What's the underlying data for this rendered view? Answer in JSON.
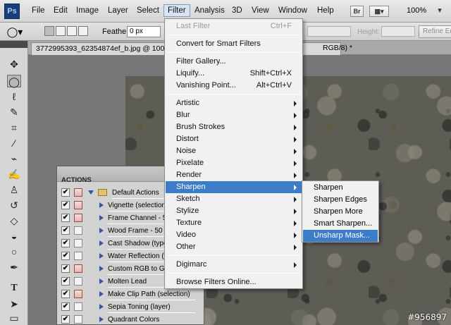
{
  "app": {
    "logo": "Ps"
  },
  "menubar": {
    "items": [
      "File",
      "Edit",
      "Image",
      "Layer",
      "Select",
      "Filter",
      "Analysis",
      "3D",
      "View",
      "Window",
      "Help"
    ],
    "active": "Filter",
    "br_button": "Br",
    "zoom": "100%"
  },
  "options": {
    "feather_label": "Feather:",
    "feather_value": "0 px",
    "height_label": "Height:",
    "refine_label": "Refine Ed"
  },
  "document": {
    "tab_title": "3772995393_62354874ef_b.jpg @ 100% (",
    "tab_title_tail": "RGB/8) *"
  },
  "filter_menu": {
    "last_filter": {
      "label": "Last Filter",
      "shortcut": "Ctrl+F"
    },
    "convert_smart": "Convert for Smart Filters",
    "filter_gallery": "Filter Gallery...",
    "liquify": {
      "label": "Liquify...",
      "shortcut": "Shift+Ctrl+X"
    },
    "vanishing_point": {
      "label": "Vanishing Point...",
      "shortcut": "Alt+Ctrl+V"
    },
    "categories": [
      "Artistic",
      "Blur",
      "Brush Strokes",
      "Distort",
      "Noise",
      "Pixelate",
      "Render",
      "Sharpen",
      "Sketch",
      "Stylize",
      "Texture",
      "Video",
      "Other"
    ],
    "highlighted": "Sharpen",
    "digimarc": "Digimarc",
    "browse_online": "Browse Filters Online..."
  },
  "sharpen_submenu": {
    "items": [
      "Sharpen",
      "Sharpen Edges",
      "Sharpen More",
      "Smart Sharpen...",
      "Unsharp Mask..."
    ],
    "highlighted": "Unsharp Mask..."
  },
  "actions_panel": {
    "title": "ACTIONS",
    "set_name": "Default Actions",
    "items": [
      "Vignette (selection)",
      "Frame Channel - 50",
      "Wood Frame - 50 p",
      "Cast Shadow (type",
      "Water Reflection (ty",
      "Custom RGB to Gra",
      "Molten Lead",
      "Make Clip Path (selection)",
      "Sepia Toning (layer)",
      "Quadrant Colors"
    ]
  },
  "watermark": "#956897"
}
